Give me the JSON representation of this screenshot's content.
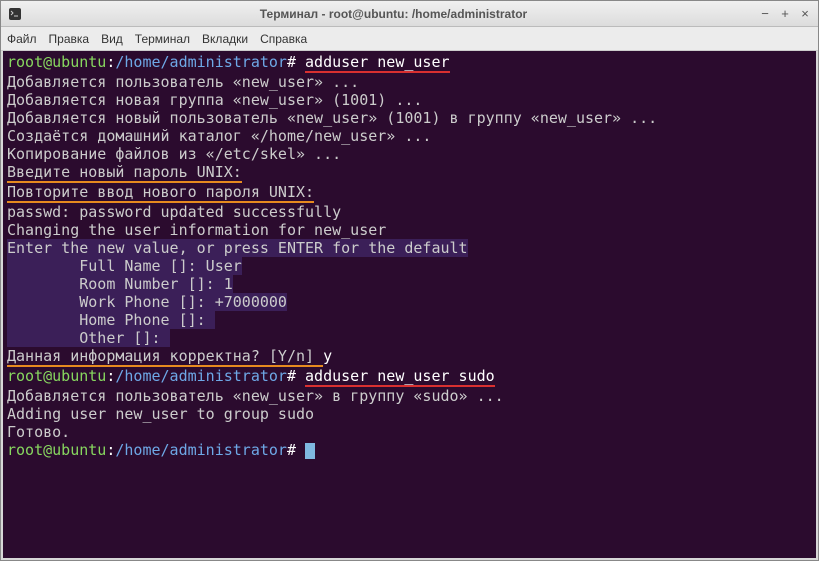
{
  "window": {
    "title": "Терминал - root@ubuntu: /home/administrator"
  },
  "menu": {
    "file": "Файл",
    "edit": "Правка",
    "view": "Вид",
    "terminal": "Терминал",
    "tabs": "Вкладки",
    "help": "Справка"
  },
  "prompt": {
    "userhost": "root@ubuntu",
    "sep": ":",
    "path": "/home/administrator",
    "hash": "#"
  },
  "cmds": {
    "adduser1": "adduser new_user",
    "adduser2": "adduser new_user sudo"
  },
  "out": {
    "l1": "Добавляется пользователь «new_user» ...",
    "l2": "Добавляется новая группа «new_user» (1001) ...",
    "l3": "Добавляется новый пользователь «new_user» (1001) в группу «new_user» ...",
    "l4": "Создаётся домашний каталог «/home/new_user» ...",
    "l5": "Копирование файлов из «/etc/skel» ...",
    "l6": "Введите новый пароль UNIX:",
    "l7": "Повторите ввод нового пароля UNIX:",
    "l8": "passwd: password updated successfully",
    "l9": "Changing the user information for new_user",
    "l10": "Enter the new value, or press ENTER for the default",
    "l11": "        Full Name []: User",
    "l12": "        Room Number []: 1",
    "l13": "        Work Phone []: +7000000",
    "l14": "        Home Phone []: ",
    "l15": "        Other []: ",
    "l16a": "Данная информация корректна? [Y/n] ",
    "l16b": "y",
    "l17": "Добавляется пользователь «new_user» в группу «sudo» ...",
    "l18": "Adding user new_user to group sudo",
    "l19": "Готово."
  }
}
